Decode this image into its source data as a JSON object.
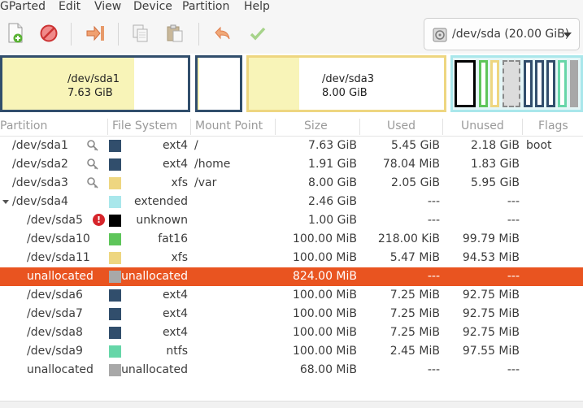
{
  "menubar": {
    "items": [
      "GParted",
      "Edit",
      "View",
      "Device",
      "Partition",
      "Help"
    ]
  },
  "toolbar": {
    "buttons": [
      "new-icon",
      "delete-icon",
      "resize-move-icon",
      "copy-icon",
      "paste-icon",
      "undo-icon",
      "apply-icon"
    ],
    "device_selector": "/dev/sda (20.00 GiB)"
  },
  "partition_map": {
    "blocks": [
      {
        "name": "/dev/sda1",
        "size": "7.63 GiB"
      },
      {
        "name": "/dev/sda3",
        "size": "8.00 GiB"
      }
    ]
  },
  "table": {
    "headers": [
      "Partition",
      "File System",
      "Mount Point",
      "Size",
      "Used",
      "Unused",
      "Flags"
    ],
    "rows": [
      {
        "partition": "/dev/sda1",
        "fs": "ext4",
        "mount": "/",
        "size": "7.63 GiB",
        "used": "5.45 GiB",
        "unused": "2.18 GiB",
        "flags": "boot",
        "color": "#314e6c",
        "icon": "lock-icon",
        "indent": 0
      },
      {
        "partition": "/dev/sda2",
        "fs": "ext4",
        "mount": "/home",
        "size": "1.91 GiB",
        "used": "78.04 MiB",
        "unused": "1.83 GiB",
        "flags": "",
        "color": "#314e6c",
        "icon": "lock-icon",
        "indent": 0
      },
      {
        "partition": "/dev/sda3",
        "fs": "xfs",
        "mount": "/var",
        "size": "8.00 GiB",
        "used": "2.05 GiB",
        "unused": "5.95 GiB",
        "flags": "",
        "color": "#eed680",
        "icon": "lock-icon",
        "indent": 0
      },
      {
        "partition": "/dev/sda4",
        "fs": "extended",
        "mount": "",
        "size": "2.46 GiB",
        "used": "---",
        "unused": "---",
        "flags": "",
        "color": "#a9e7eb",
        "icon": "",
        "indent": 0,
        "expanded": true
      },
      {
        "partition": "/dev/sda5",
        "fs": "unknown",
        "mount": "",
        "size": "1.00 GiB",
        "used": "---",
        "unused": "---",
        "flags": "",
        "color": "#000000",
        "icon": "warning-icon",
        "indent": 1
      },
      {
        "partition": "/dev/sda10",
        "fs": "fat16",
        "mount": "",
        "size": "100.00 MiB",
        "used": "218.00 KiB",
        "unused": "99.79 MiB",
        "flags": "",
        "color": "#5ec55a",
        "icon": "",
        "indent": 1
      },
      {
        "partition": "/dev/sda11",
        "fs": "xfs",
        "mount": "",
        "size": "100.00 MiB",
        "used": "5.47 MiB",
        "unused": "94.53 MiB",
        "flags": "",
        "color": "#eed680",
        "icon": "",
        "indent": 1
      },
      {
        "partition": "unallocated",
        "fs": "unallocated",
        "mount": "",
        "size": "824.00 MiB",
        "used": "---",
        "unused": "---",
        "flags": "",
        "color": "#a8a8a8",
        "icon": "",
        "indent": 1,
        "selected": true
      },
      {
        "partition": "/dev/sda6",
        "fs": "ext4",
        "mount": "",
        "size": "100.00 MiB",
        "used": "7.25 MiB",
        "unused": "92.75 MiB",
        "flags": "",
        "color": "#314e6c",
        "icon": "",
        "indent": 1
      },
      {
        "partition": "/dev/sda7",
        "fs": "ext4",
        "mount": "",
        "size": "100.00 MiB",
        "used": "7.25 MiB",
        "unused": "92.75 MiB",
        "flags": "",
        "color": "#314e6c",
        "icon": "",
        "indent": 1
      },
      {
        "partition": "/dev/sda8",
        "fs": "ext4",
        "mount": "",
        "size": "100.00 MiB",
        "used": "7.25 MiB",
        "unused": "92.75 MiB",
        "flags": "",
        "color": "#314e6c",
        "icon": "",
        "indent": 1
      },
      {
        "partition": "/dev/sda9",
        "fs": "ntfs",
        "mount": "",
        "size": "100.00 MiB",
        "used": "2.45 MiB",
        "unused": "97.55 MiB",
        "flags": "",
        "color": "#66d6a8",
        "icon": "",
        "indent": 1
      },
      {
        "partition": "unallocated",
        "fs": "unallocated",
        "mount": "",
        "size": "68.00 MiB",
        "used": "---",
        "unused": "---",
        "flags": "",
        "color": "#a8a8a8",
        "icon": "",
        "indent": 1
      }
    ]
  },
  "colors": {
    "accent": "#e95420",
    "ext4": "#314e6c",
    "xfs": "#eed680",
    "extended": "#a9e7eb",
    "fat16": "#5ec55a",
    "ntfs": "#66d6a8",
    "unallocated": "#a8a8a8"
  }
}
